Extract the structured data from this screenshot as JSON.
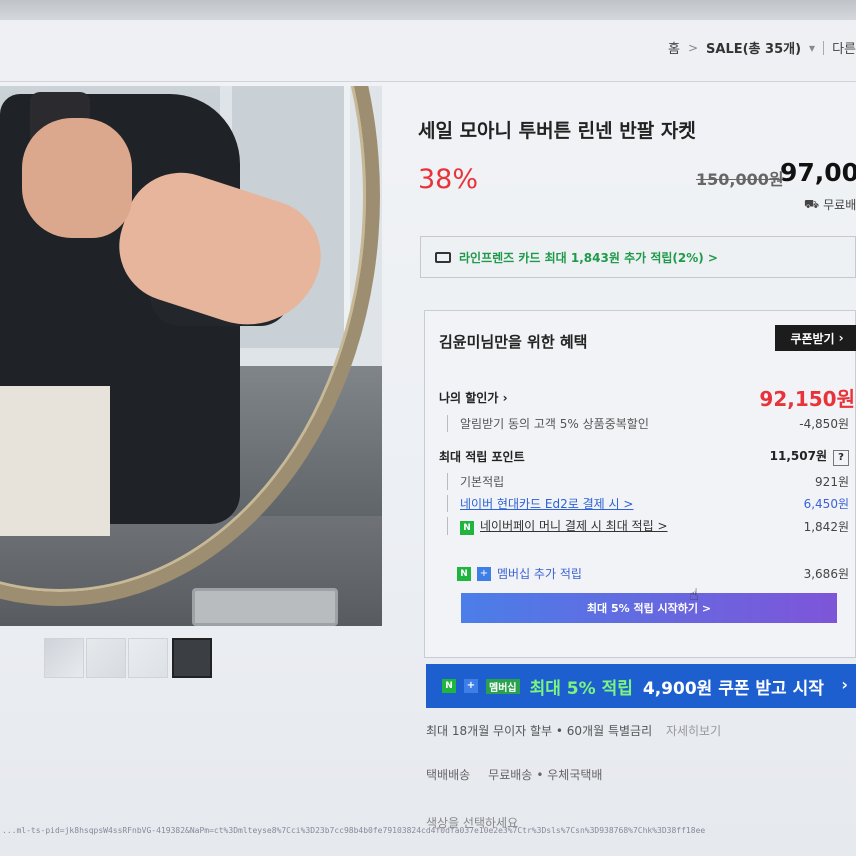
{
  "breadcrumb": {
    "home": "홈",
    "sale": "SALE(총 35개)",
    "other": "다른"
  },
  "product": {
    "title": "세일 모아니 투버튼 린넨 반팔 자켓",
    "discount_rate": "38%",
    "original_price": "150,000원",
    "price": "97,000",
    "shipping_note": "무료배"
  },
  "card_banner": {
    "text": "라인프렌즈 카드 최대 1,843원 추가 적립(2%) >"
  },
  "benefit": {
    "title": "김윤미님만을 위한 혜택",
    "coupon_button": "쿠폰받기",
    "my_price_label": "나의 할인가",
    "my_price_value": "92,150원",
    "alarm_discount_label": "알림받기 동의 고객 5% 상품중복할인",
    "alarm_discount_value": "-4,850원",
    "max_points_label": "최대 적립 포인트",
    "max_points_value": "11,507원",
    "basic_label": "기본적립",
    "basic_value": "921원",
    "naver_card_label": "네이버 현대카드 Ed2로 결제 시 >",
    "naver_card_value": "6,450원",
    "naverpay_label": "네이버페이 머니 결제 시 최대 적립 >",
    "naverpay_value": "1,842원",
    "membership_label": "멤버십 추가 적립",
    "membership_value": "3,686원",
    "start_bar": "최대 5% 적립 시작하기 >"
  },
  "big_banner": {
    "badge_text": "멤버십",
    "highlight": "최대 5% 적립",
    "rest": "4,900원 쿠폰 받고 시작"
  },
  "installment": {
    "text": "최대 18개월 무이자 할부 • 60개월 특별금리",
    "more": "자세히보기"
  },
  "shipping": {
    "label": "택배배송",
    "free": "무료배송",
    "carrier": "• 우체국택배"
  },
  "option": {
    "text": "색상을 선택하세요"
  },
  "url": {
    "text": "...ml-ts-pid=jk8hsqpsW4ssRFnbVG-419382&NaPm=ct%3Dmlteyse8%7Cci%3D23b7cc98b4b0fe79103824cd4f0dfa037e10e2e3%7Ctr%3Dsls%7Csn%3D938768%7Chk%3D38ff18ee"
  },
  "colors": {
    "discount_red": "#e8333a",
    "naver_green": "#1fb53f",
    "banner_blue": "#1e5fd0"
  }
}
